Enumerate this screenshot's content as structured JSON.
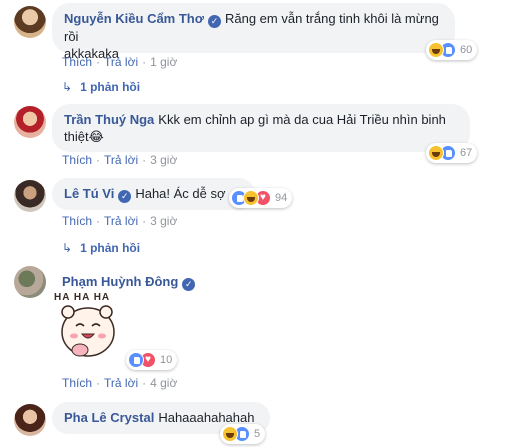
{
  "actions": {
    "like": "Thích",
    "reply": "Trả lời",
    "dot": "·"
  },
  "comments": [
    {
      "name": "Nguyễn Kiều Cẩm Thơ",
      "text1": "Răng em vẫn trắng tinh khôi là mừng rồi",
      "text2": "akkakaka",
      "time": "1 giờ",
      "reactions": [
        "haha-icon",
        "like-icon"
      ],
      "count": "60",
      "replies": "1 phản hồi"
    },
    {
      "name": "Trần Thuý Nga",
      "text1": "Kkk em chỉnh ap gì mà da cua Hải Triều nhìn binh",
      "text2": "thiệt😂",
      "time": "3 giờ",
      "reactions": [
        "haha-icon",
        "like-icon"
      ],
      "count": "67"
    },
    {
      "name": "Lê Tú Vi",
      "text1": "Haha! Ác dễ sợ",
      "time": "3 giờ",
      "reactions": [
        "like-icon",
        "haha-icon",
        "love-icon"
      ],
      "count": "94",
      "replies": "1 phản hồi"
    },
    {
      "name": "Phạm Huỳnh Đông",
      "sticker_text": "HA HA HA",
      "time": "4 giờ",
      "reactions": [
        "like-icon",
        "love-icon"
      ],
      "count": "10"
    },
    {
      "name": "Pha Lê Crystal",
      "text1": "Hahaaahahahah",
      "reactions": [
        "haha-icon",
        "like-icon"
      ],
      "count": "5"
    }
  ],
  "colors": {
    "name_link": "#385898",
    "bubble_bg": "#f2f3f5",
    "action_link": "#4267b2",
    "meta_gray": "#90949c"
  }
}
